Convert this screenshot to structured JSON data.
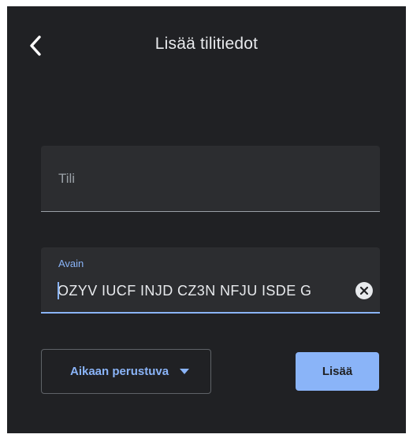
{
  "header": {
    "title": "Lisää tilitiedot",
    "back_icon": "chevron-left-icon"
  },
  "account_field": {
    "placeholder": "Tili",
    "value": ""
  },
  "key_field": {
    "label": "Avain",
    "value": "OZYV IUCF INJD CZ3N NFJU ISDE G",
    "clear_icon": "clear-circle-icon"
  },
  "type_dropdown": {
    "selected": "Aikaan perustuva",
    "arrow_icon": "caret-down-icon"
  },
  "add_button": {
    "label": "Lisää"
  },
  "colors": {
    "background": "#202124",
    "field_background": "#2c2d30",
    "accent": "#8ab4f8",
    "text": "#e8eaed",
    "muted_text": "#9aa0a6"
  }
}
